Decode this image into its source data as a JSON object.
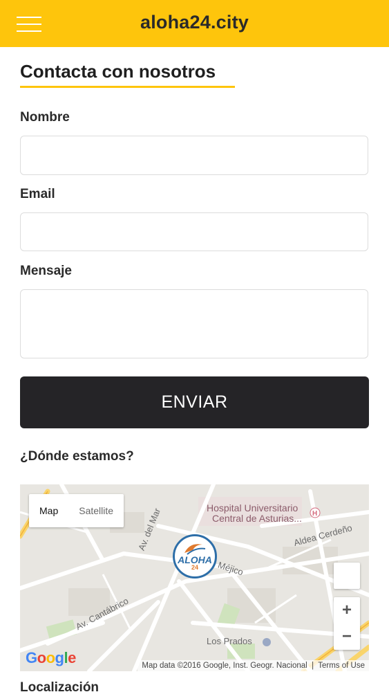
{
  "header": {
    "brand": "aloha24.city",
    "menu_icon": "hamburger-menu-icon",
    "color": "#fec50c"
  },
  "form": {
    "title": "Contacta con nosotros",
    "name_label": "Nombre",
    "name_value": "",
    "email_label": "Email",
    "email_value": "",
    "message_label": "Mensaje",
    "message_value": "",
    "submit_label": "ENVIAR"
  },
  "location": {
    "heading": "¿Dónde estamos?",
    "footer_heading": "Localización"
  },
  "map": {
    "type_map": "Map",
    "type_satellite": "Satellite",
    "zoom_in": "+",
    "zoom_out": "−",
    "labels": {
      "hospital_1": "Hospital Universitario",
      "hospital_2": "Central de Asturias...",
      "aldea": "Aldea Cerdeño",
      "av_mar": "Av. del Mar",
      "mejico": "Méjico",
      "av_cantabrico": "Av. Cantábrico",
      "los_prados": "Los Prados"
    },
    "marker_text": "ALOHA",
    "marker_num": "24",
    "google": "Google",
    "attribution": "Map data ©2016 Google, Inst. Geogr. Nacional",
    "terms": "Terms of Use"
  }
}
